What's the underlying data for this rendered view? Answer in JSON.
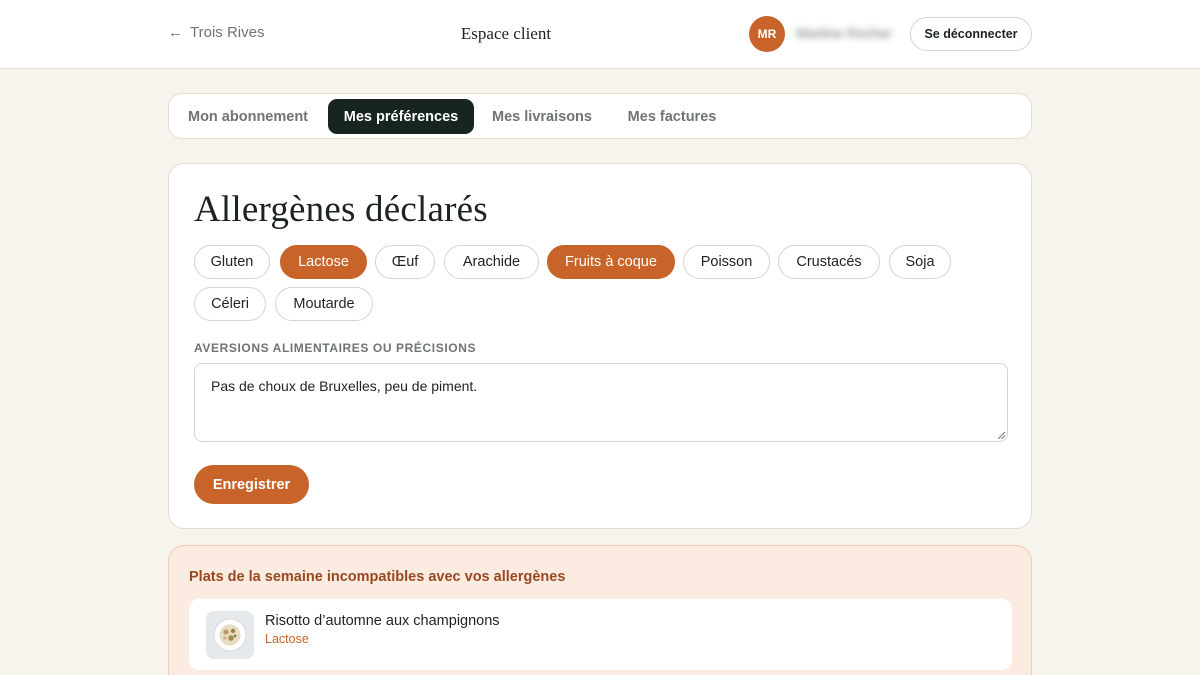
{
  "header": {
    "back_arrow": "←",
    "back_label": "Trois Rives",
    "title": "Espace client",
    "avatar_initials": "MR",
    "user_name": "Martine Rocher",
    "logout_label": "Se déconnecter"
  },
  "tabs": [
    {
      "label": "Mon abonnement",
      "active": false
    },
    {
      "label": "Mes préférences",
      "active": true
    },
    {
      "label": "Mes livraisons",
      "active": false
    },
    {
      "label": "Mes factures",
      "active": false
    }
  ],
  "allergens": {
    "title": "Allergènes déclarés",
    "chips": [
      {
        "label": "Gluten",
        "selected": false
      },
      {
        "label": "Lactose",
        "selected": true
      },
      {
        "label": "Œuf",
        "selected": false
      },
      {
        "label": "Arachide",
        "selected": false
      },
      {
        "label": "Fruits à coque",
        "selected": true
      },
      {
        "label": "Poisson",
        "selected": false
      },
      {
        "label": "Crustacés",
        "selected": false
      },
      {
        "label": "Soja",
        "selected": false
      },
      {
        "label": "Céleri",
        "selected": false
      },
      {
        "label": "Moutarde",
        "selected": false
      }
    ],
    "aversions_label": "AVERSIONS ALIMENTAIRES OU PRÉCISIONS",
    "aversions_value": "Pas de choux de Bruxelles, peu de piment.",
    "save_label": "Enregistrer"
  },
  "incompatible": {
    "title": "Plats de la semaine incompatibles avec vos allergènes",
    "dishes": [
      {
        "name": "Risotto d’automne aux champignons",
        "allergen": "Lactose"
      }
    ]
  },
  "colors": {
    "accent": "#c8642a",
    "dark": "#18251f",
    "background": "#f7f4ee",
    "alert_bg": "#fbebe0",
    "alert_text": "#9a4820"
  }
}
